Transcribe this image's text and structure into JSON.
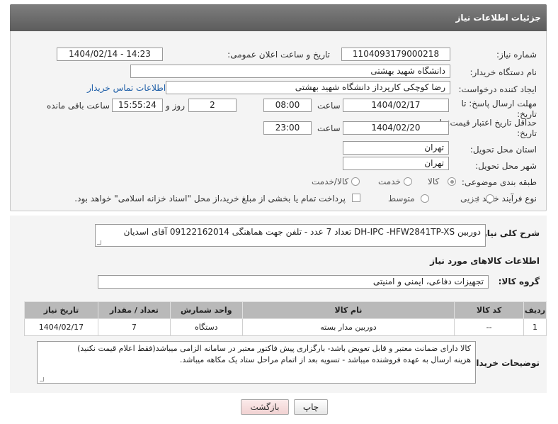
{
  "header": {
    "title": "جزئیات اطلاعات نیاز"
  },
  "form": {
    "need_number_label": "شماره نیاز:",
    "need_number": "1104093179000218",
    "announce_label": "تاریخ و ساعت اعلان عمومی:",
    "announce_value": "1404/02/14 - 14:23",
    "buyer_org_label": "نام دستگاه خریدار:",
    "buyer_org": "دانشگاه شهید بهشتی",
    "requester_label": "ایجاد کننده درخواست:",
    "requester": "رضا کوچکی کارپرداز دانشگاه شهید بهشتی",
    "buyer_contact_link": "اطلاعات تماس خریدار",
    "deadline_label": "مهلت ارسال پاسخ: تا تاریخ:",
    "deadline_date": "1404/02/17",
    "time_label": "ساعت",
    "deadline_time": "08:00",
    "days_value": "2",
    "days_label": "روز و",
    "remaining_time": "15:55:24",
    "remaining_label": "ساعت باقی مانده",
    "validity_label": "حداقل تاریخ اعتبار قیمت: تا تاریخ:",
    "validity_date": "1404/02/20",
    "validity_time": "23:00",
    "province_label": "استان محل تحویل:",
    "province": "تهران",
    "city_label": "شهر محل تحویل:",
    "city": "تهران",
    "category_label": "طبقه بندی موضوعی:",
    "category_options": [
      "کالا",
      "خدمت",
      "کالا/خدمت"
    ],
    "process_label": "نوع فرآیند خرید :",
    "process_options": [
      "جزیی",
      "متوسط"
    ],
    "payment_note": "پرداخت تمام یا بخشی از مبلغ خرید،از محل \"اسناد خزانه اسلامی\" خواهد بود."
  },
  "description": {
    "label": "شرح کلی نیاز:",
    "text": "دوربین DH-IPC -HFW2841TP-XS تعداد 7 عدد - تلفن جهت هماهنگی 09122162014 آقای اسدیان"
  },
  "goods": {
    "section_title": "اطلاعات کالاهای مورد نیاز",
    "group_label": "گروه کالا:",
    "group_value": "تجهیزات دفاعی، ایمنی و امنیتی",
    "columns": [
      "ردیف",
      "کد کالا",
      "نام کالا",
      "واحد شمارش",
      "تعداد / مقدار",
      "تاریخ نیاز"
    ],
    "rows": [
      [
        "1",
        "--",
        "دوربین مدار بسته",
        "دستگاه",
        "7",
        "1404/02/17"
      ]
    ]
  },
  "buyer_notes": {
    "label": "توضیحات خریدار:",
    "line1": "کالا دارای ضمانت معتبر و قابل تعویض باشد- بارگزاری پیش فاکتور معتبر در سامانه الزامی میباشد(فقط اعلام قیمت نکنید)",
    "line2": "هزینه ارسال به عهده فروشنده میباشد - تسویه بعد از اتمام مراحل ستاد یک مکاهه میباشد."
  },
  "buttons": {
    "print": "چاپ",
    "back": "بازگشت"
  },
  "colors": {
    "header_bg": "#6e6e6e",
    "link": "#1f5fa8",
    "back_btn": "#f1d2d2"
  }
}
